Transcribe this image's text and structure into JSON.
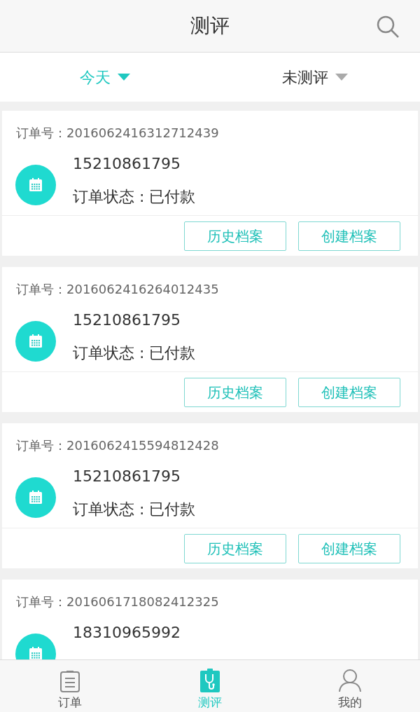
{
  "header": {
    "title": "测评"
  },
  "filters": [
    {
      "label": "今天",
      "selected": true
    },
    {
      "label": "未测评",
      "selected": false
    }
  ],
  "orders": [
    {
      "order_label": "订单号：",
      "order_no": "2016062416312712439",
      "phone": "15210861795",
      "status": "订单状态 : 已付款",
      "buttons": [
        "历史档案",
        "创建档案"
      ]
    },
    {
      "order_label": "订单号：",
      "order_no": "2016062416264012435",
      "phone": "15210861795",
      "status": "订单状态 : 已付款",
      "buttons": [
        "历史档案",
        "创建档案"
      ]
    },
    {
      "order_label": "订单号：",
      "order_no": "2016062415594812428",
      "phone": "15210861795",
      "status": "订单状态 : 已付款",
      "buttons": [
        "历史档案",
        "创建档案"
      ]
    },
    {
      "order_label": "订单号：",
      "order_no": "2016061718082412325",
      "phone": "18310965992"
    }
  ],
  "nav": [
    {
      "kind": "orders",
      "label": "订单",
      "selected": false
    },
    {
      "kind": "assess",
      "label": "测评",
      "selected": true
    },
    {
      "kind": "profile",
      "label": "我的",
      "selected": false
    }
  ]
}
